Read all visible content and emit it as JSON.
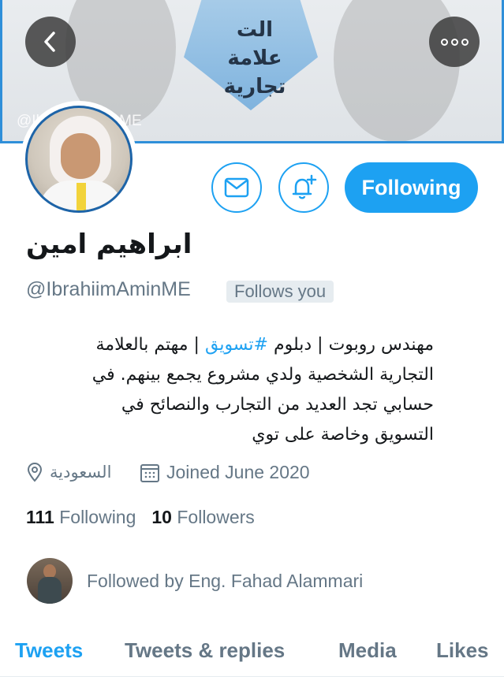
{
  "header": {
    "banner_text": [
      "الت",
      "علامة",
      "تجارية"
    ],
    "banner_watermark": "@IbrahiimAminME",
    "back_icon": "chevron-left-icon",
    "more_icon": "more-dots-icon"
  },
  "actions": {
    "mail_icon": "mail-icon",
    "notify_icon": "bell-plus-icon",
    "follow_label": "Following"
  },
  "profile": {
    "display_name": "ابراهيم امين",
    "handle": "@IbrahiimAminME",
    "follows_you": "Follows you",
    "bio_lines": [
      {
        "before": "مهندس روبوت | دبلوم ",
        "hashtag": "#تسويق",
        "after": " | مهتم بالعلامة"
      },
      {
        "before": "التجارية الشخصية ولدي مشروع يجمع بينهم. في",
        "hashtag": "",
        "after": ""
      },
      {
        "before": "حسابي تجد العديد من التجارب والنصائح في",
        "hashtag": "",
        "after": ""
      },
      {
        "before": "التسويق وخاصة على توي",
        "hashtag": "",
        "after": ""
      }
    ],
    "location": "السعودية",
    "joined": "Joined June 2020"
  },
  "stats": {
    "following_count": "111",
    "following_label": "Following",
    "followers_count": "10",
    "followers_label": "Followers"
  },
  "followed_by": {
    "text": "Followed by Eng. Fahad Alammari"
  },
  "tabs": [
    {
      "label": "Tweets",
      "active": true
    },
    {
      "label": "Tweets & replies",
      "active": false
    },
    {
      "label": "Media",
      "active": false
    },
    {
      "label": "Likes",
      "active": false
    }
  ],
  "colors": {
    "accent": "#1da1f2",
    "secondary_text": "#657786",
    "primary_text": "#14171a"
  }
}
